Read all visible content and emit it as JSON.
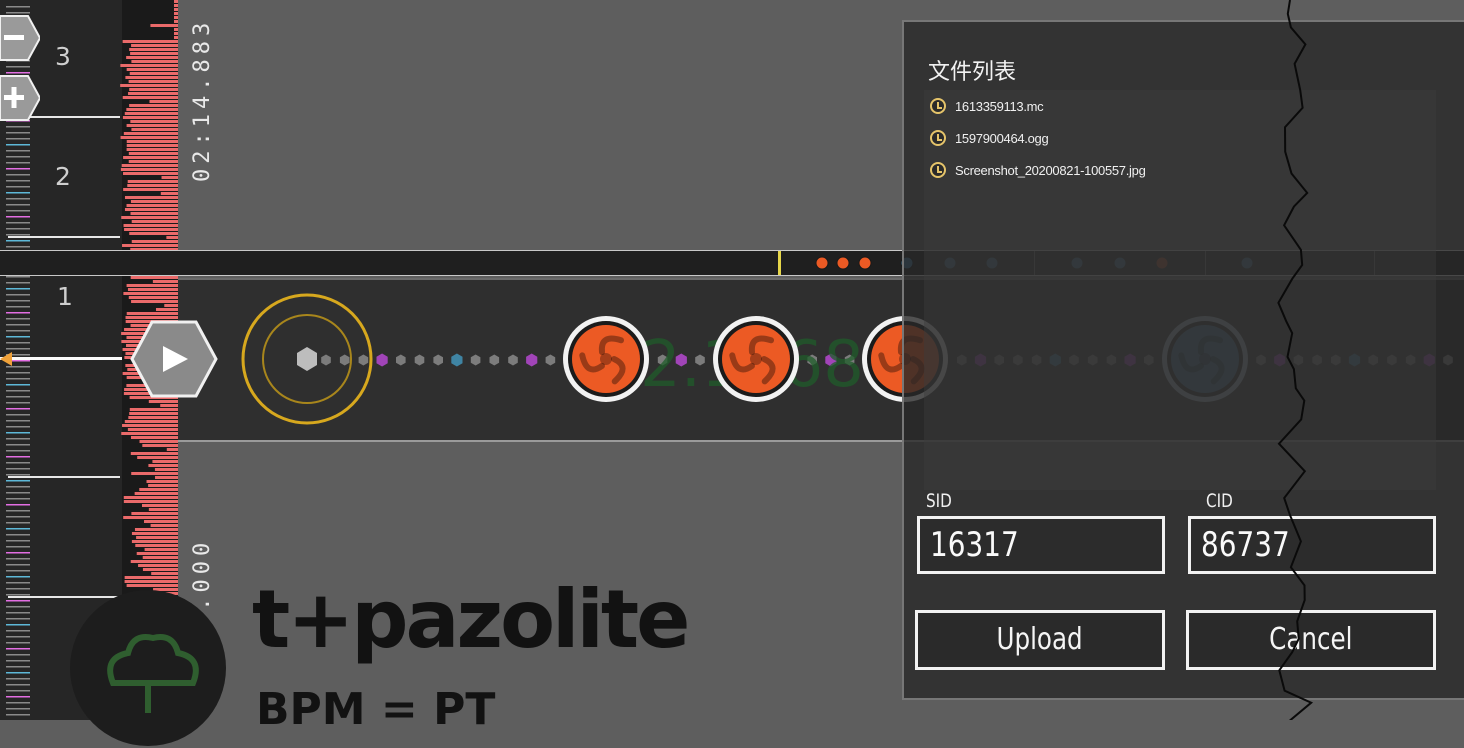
{
  "timeline": {
    "measures": [
      "3",
      "2",
      "1"
    ],
    "time_end": "02:14.883",
    "time_start": "00:00.000",
    "overlay_number": "2.1968"
  },
  "zoom": {
    "out_icon": "minus-icon",
    "in_icon": "plus-icon"
  },
  "player": {
    "play_icon": "play-icon"
  },
  "song": {
    "artist": "t+pazolite",
    "bpm_label": "BPM = PT"
  },
  "dialog": {
    "title": "文件列表",
    "files": [
      {
        "name": "1613359113.mc",
        "icon": "clock-icon"
      },
      {
        "name": "1597900464.ogg",
        "icon": "clock-icon"
      },
      {
        "name": "Screenshot_20200821-100557.jpg",
        "icon": "clock-icon"
      }
    ],
    "sid_label": "SID",
    "sid_value": "16317",
    "cid_label": "CID",
    "cid_value": "86737",
    "upload_label": "Upload",
    "cancel_label": "Cancel"
  },
  "colors": {
    "note_orange": "#ec5a24",
    "note_blue": "#3d6f8f",
    "waveform": "#ea6a6a",
    "tick_pink": "#e36ee3",
    "tick_blue": "#5db8d8",
    "selection_ring": "#d7a81e",
    "file_icon": "#e5c46a"
  }
}
